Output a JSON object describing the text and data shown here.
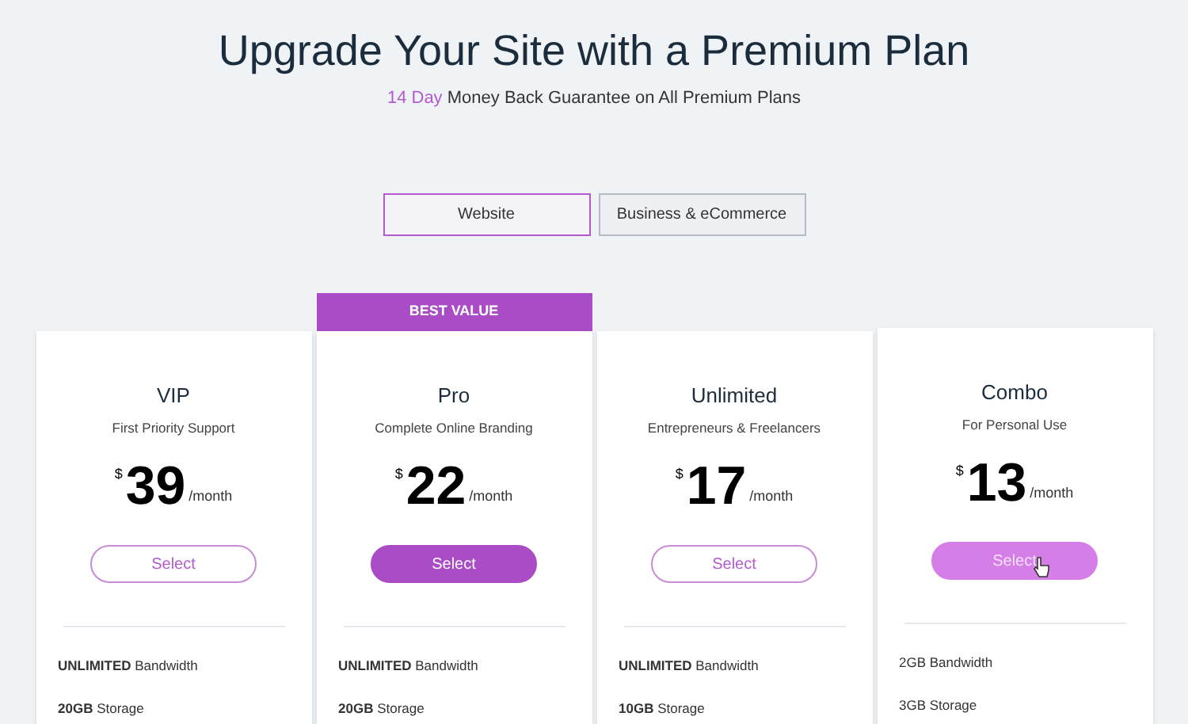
{
  "header": {
    "title": "Upgrade Your Site with a Premium Plan",
    "subtitle_highlight": "14 Day",
    "subtitle": "Money Back Guarantee on All Premium Plans"
  },
  "tabs": [
    {
      "label": "Website",
      "selected": true
    },
    {
      "label": "Business & eCommerce",
      "selected": false
    }
  ],
  "plans": [
    {
      "name": "VIP",
      "tagline": "First Priority Support",
      "currency": "$",
      "price": "39",
      "period": "/month",
      "button": "Select",
      "kind": "outline",
      "hovered": false,
      "features": [
        "**UNLIMITED** Bandwidth",
        "**20GB** Storage"
      ]
    },
    {
      "name": "Pro",
      "tagline": "Complete Online Branding",
      "currency": "$",
      "price": "22",
      "period": "/month",
      "button": "Select",
      "kind": "filled",
      "hovered": false,
      "badge": "BEST VALUE",
      "features": [
        "**UNLIMITED** Bandwidth",
        "**20GB** Storage"
      ]
    },
    {
      "name": "Unlimited",
      "tagline": "Entrepreneurs & Freelancers",
      "currency": "$",
      "price": "17",
      "period": "/month",
      "button": "Select",
      "kind": "outline",
      "hovered": false,
      "features": [
        "**UNLIMITED** Bandwidth",
        "**10GB** Storage"
      ]
    },
    {
      "name": "Combo",
      "tagline": "For Personal Use",
      "currency": "$",
      "price": "13",
      "period": "/month",
      "button": "Select",
      "kind": "outline",
      "hovered": true,
      "features": [
        "2GB Bandwidth",
        "3GB Storage"
      ]
    }
  ]
}
